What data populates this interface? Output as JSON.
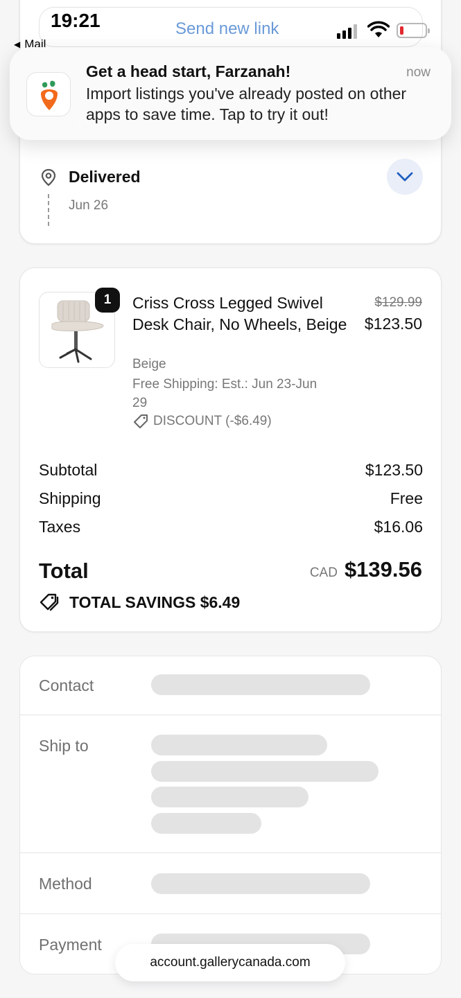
{
  "status_bar": {
    "time": "19:21",
    "back_label": "Mail",
    "center_link": "Send new link"
  },
  "notification": {
    "title": "Get a head start, Farzanah!",
    "time": "now",
    "body": "Import listings you've already posted on other apps to save time. Tap to try it out!",
    "icon": "carrot-app-icon"
  },
  "delivery": {
    "status": "Delivered",
    "date": "Jun 26"
  },
  "order": {
    "item": {
      "quantity": "1",
      "name": "Criss Cross Legged Swivel Desk Chair, No Wheels, Beige",
      "variant": "Beige",
      "shipping": "Free Shipping: Est.: Jun 23-Jun 29",
      "discount": "DISCOUNT (-$6.49)",
      "original_price": "$129.99",
      "price": "$123.50"
    },
    "summary": {
      "subtotal_label": "Subtotal",
      "subtotal": "$123.50",
      "shipping_label": "Shipping",
      "shipping": "Free",
      "taxes_label": "Taxes",
      "taxes": "$16.06",
      "total_label": "Total",
      "currency": "CAD",
      "total": "$139.56",
      "savings": "TOTAL SAVINGS $6.49"
    }
  },
  "info": {
    "contact_label": "Contact",
    "ship_to_label": "Ship to",
    "method_label": "Method",
    "payment_label": "Payment"
  },
  "browser": {
    "url": "account.gallerycanada.com"
  },
  "colors": {
    "link": "#6a9ad8",
    "chevron_bg": "#e9eef8",
    "chevron": "#1f5fbf",
    "battery_low": "#e0292e",
    "carrot": "#f26a1b",
    "leaf": "#2e9b59"
  }
}
